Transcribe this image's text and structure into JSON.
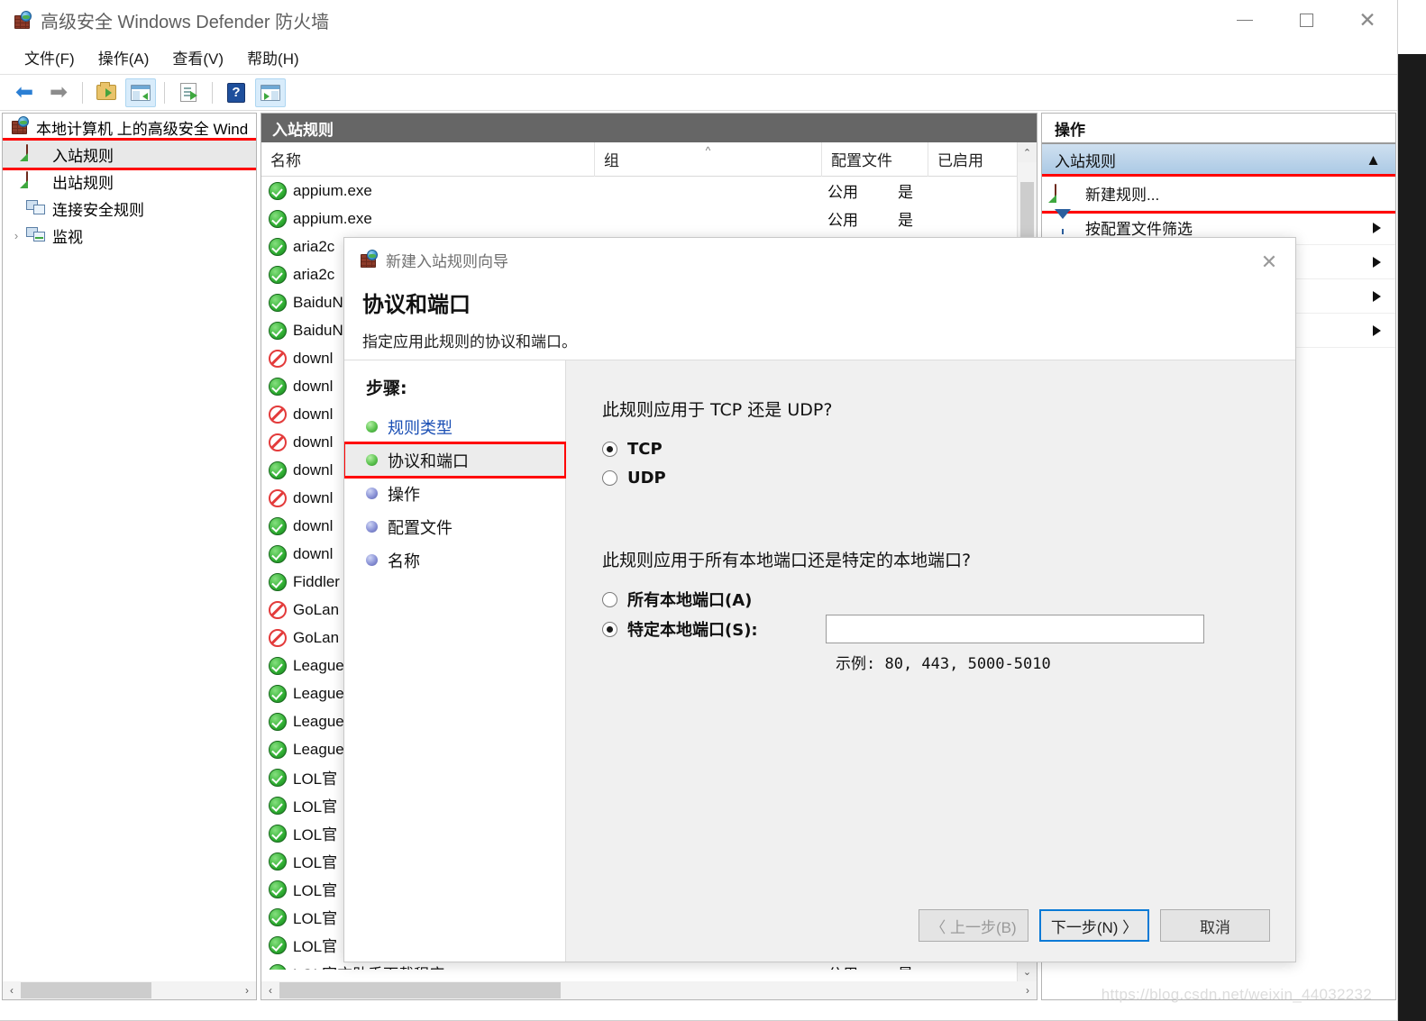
{
  "window": {
    "title": "高级安全 Windows Defender 防火墙",
    "icon": "firewall-globe-icon",
    "controls": {
      "minimize": "—",
      "maximize": "□",
      "close": "✕"
    }
  },
  "menubar": {
    "items": [
      {
        "label": "文件(F)",
        "name": "menu-file"
      },
      {
        "label": "操作(A)",
        "name": "menu-action"
      },
      {
        "label": "查看(V)",
        "name": "menu-view"
      },
      {
        "label": "帮助(H)",
        "name": "menu-help"
      }
    ]
  },
  "toolbar": {
    "buttons": [
      {
        "name": "back-button",
        "icon": "arrow-left-icon",
        "glyph": "⬅"
      },
      {
        "name": "forward-button",
        "icon": "arrow-right-icon",
        "glyph": "➡"
      },
      {
        "name": "up-folder-button",
        "icon": "folder-up-icon"
      },
      {
        "name": "show-hide-tree-button",
        "icon": "show-tree-icon",
        "highlighted": true
      },
      {
        "name": "export-list-button",
        "icon": "export-list-icon"
      },
      {
        "name": "help-button",
        "icon": "question-mark-icon",
        "glyph": "?"
      },
      {
        "name": "show-action-pane-button",
        "icon": "show-action-pane-icon",
        "highlighted": true
      }
    ]
  },
  "tree": {
    "root": {
      "label": "本地计算机 上的高级安全 Wind",
      "icon": "firewall-globe-icon"
    },
    "items": [
      {
        "label": "入站规则",
        "icon": "inbound-rules-icon",
        "selected": true,
        "highlighted": true,
        "expander": ""
      },
      {
        "label": "出站规则",
        "icon": "outbound-rules-icon",
        "selected": false,
        "highlighted": false,
        "expander": ""
      },
      {
        "label": "连接安全规则",
        "icon": "connection-security-icon",
        "selected": false,
        "highlighted": false,
        "expander": ""
      },
      {
        "label": "监视",
        "icon": "monitoring-icon",
        "selected": false,
        "highlighted": false,
        "expander": "›"
      }
    ]
  },
  "list": {
    "header": "入站规则",
    "columns": [
      {
        "label": "名称",
        "name": "column-name"
      },
      {
        "label": "组",
        "name": "column-group",
        "sort": "^"
      },
      {
        "label": "配置文件",
        "name": "column-profile"
      },
      {
        "label": "已启用",
        "name": "column-enabled"
      }
    ],
    "rows": [
      {
        "name": "appium.exe",
        "status": "allow",
        "group": "",
        "profile": "公用",
        "enabled": "是"
      },
      {
        "name": "appium.exe",
        "status": "allow",
        "group": "",
        "profile": "公用",
        "enabled": "是"
      },
      {
        "name": "aria2c",
        "status": "allow",
        "group": "",
        "profile": "",
        "enabled": ""
      },
      {
        "name": "aria2c",
        "status": "allow",
        "group": "",
        "profile": "",
        "enabled": ""
      },
      {
        "name": "BaiduN",
        "status": "allow",
        "group": "",
        "profile": "",
        "enabled": ""
      },
      {
        "name": "BaiduN",
        "status": "allow",
        "group": "",
        "profile": "",
        "enabled": ""
      },
      {
        "name": "downl",
        "status": "block",
        "group": "",
        "profile": "",
        "enabled": ""
      },
      {
        "name": "downl",
        "status": "allow",
        "group": "",
        "profile": "",
        "enabled": ""
      },
      {
        "name": "downl",
        "status": "block",
        "group": "",
        "profile": "",
        "enabled": ""
      },
      {
        "name": "downl",
        "status": "block",
        "group": "",
        "profile": "",
        "enabled": ""
      },
      {
        "name": "downl",
        "status": "allow",
        "group": "",
        "profile": "",
        "enabled": ""
      },
      {
        "name": "downl",
        "status": "block",
        "group": "",
        "profile": "",
        "enabled": ""
      },
      {
        "name": "downl",
        "status": "allow",
        "group": "",
        "profile": "",
        "enabled": ""
      },
      {
        "name": "downl",
        "status": "allow",
        "group": "",
        "profile": "",
        "enabled": ""
      },
      {
        "name": "Fiddler",
        "status": "allow",
        "group": "",
        "profile": "",
        "enabled": ""
      },
      {
        "name": "GoLan",
        "status": "block",
        "group": "",
        "profile": "",
        "enabled": ""
      },
      {
        "name": "GoLan",
        "status": "block",
        "group": "",
        "profile": "",
        "enabled": ""
      },
      {
        "name": "League",
        "status": "allow",
        "group": "",
        "profile": "",
        "enabled": ""
      },
      {
        "name": "League",
        "status": "allow",
        "group": "",
        "profile": "",
        "enabled": ""
      },
      {
        "name": "League",
        "status": "allow",
        "group": "",
        "profile": "",
        "enabled": ""
      },
      {
        "name": "League",
        "status": "allow",
        "group": "",
        "profile": "",
        "enabled": ""
      },
      {
        "name": "LOL官",
        "status": "allow",
        "group": "",
        "profile": "",
        "enabled": ""
      },
      {
        "name": "LOL官",
        "status": "allow",
        "group": "",
        "profile": "",
        "enabled": ""
      },
      {
        "name": "LOL官",
        "status": "allow",
        "group": "",
        "profile": "",
        "enabled": ""
      },
      {
        "name": "LOL官",
        "status": "allow",
        "group": "",
        "profile": "",
        "enabled": ""
      },
      {
        "name": "LOL官",
        "status": "allow",
        "group": "",
        "profile": "",
        "enabled": ""
      },
      {
        "name": "LOL官",
        "status": "allow",
        "group": "",
        "profile": "",
        "enabled": ""
      },
      {
        "name": "LOL官",
        "status": "allow",
        "group": "",
        "profile": "",
        "enabled": ""
      },
      {
        "name": "LOL官方助手下载程序",
        "status": "allow",
        "group": "",
        "profile": "公用",
        "enabled": "是"
      }
    ]
  },
  "actions": {
    "header": "操作",
    "section": {
      "label": "入站规则",
      "collapse_glyph": "▲"
    },
    "items": [
      {
        "label": "新建规则...",
        "icon": "new-rule-icon",
        "highlighted": true,
        "submenu": false
      },
      {
        "label": "按配置文件筛选",
        "icon": "funnel-icon",
        "highlighted": false,
        "submenu": true
      },
      {
        "label": "",
        "icon": "",
        "highlighted": false,
        "submenu": true
      },
      {
        "label": "",
        "icon": "",
        "highlighted": false,
        "submenu": true
      },
      {
        "label": "",
        "icon": "",
        "highlighted": false,
        "submenu": true
      }
    ]
  },
  "dialog": {
    "title": "新建入站规则向导",
    "icon": "firewall-globe-icon",
    "close_glyph": "✕",
    "heading": "协议和端口",
    "subheading": "指定应用此规则的协议和端口。",
    "steps_title": "步骤:",
    "steps": [
      {
        "label": "规则类型",
        "state": "done",
        "link": true,
        "current": false
      },
      {
        "label": "协议和端口",
        "state": "done",
        "link": false,
        "current": true
      },
      {
        "label": "操作",
        "state": "pending",
        "link": false,
        "current": false
      },
      {
        "label": "配置文件",
        "state": "pending",
        "link": false,
        "current": false
      },
      {
        "label": "名称",
        "state": "pending",
        "link": false,
        "current": false
      }
    ],
    "question_protocol": "此规则应用于 TCP 还是 UDP?",
    "protocol_options": [
      {
        "label": "TCP",
        "selected": true
      },
      {
        "label": "UDP",
        "selected": false
      }
    ],
    "question_ports": "此规则应用于所有本地端口还是特定的本地端口?",
    "port_options": [
      {
        "label": "所有本地端口(A)",
        "selected": false
      },
      {
        "label": "特定本地端口(S):",
        "selected": true
      }
    ],
    "port_value": "",
    "port_placeholder": "",
    "hint": "示例: 80, 443, 5000-5010",
    "buttons": {
      "back": "〈 上一步(B)",
      "next": "下一步(N) 〉",
      "cancel": "取消"
    }
  },
  "watermark": "https://blog.csdn.net/weixin_44032232"
}
